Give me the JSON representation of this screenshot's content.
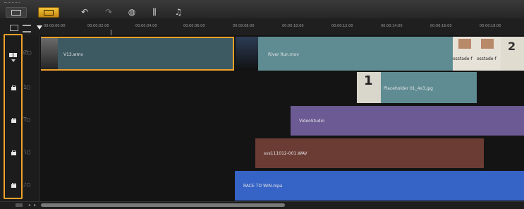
{
  "toolbar": {
    "buttons": [
      {
        "name": "storyboard-view-icon",
        "symbol": ""
      },
      {
        "name": "timeline-view-icon",
        "symbol": ""
      },
      {
        "name": "undo-icon",
        "symbol": "↶"
      },
      {
        "name": "redo-icon",
        "symbol": "↷"
      },
      {
        "name": "record-capture-icon",
        "symbol": "◍"
      },
      {
        "name": "sound-mixer-icon",
        "symbol": "⫼"
      },
      {
        "name": "auto-music-icon",
        "symbol": "♫"
      }
    ]
  },
  "ruler": {
    "times": [
      "00:00:00:00",
      "00:00:02:00",
      "00:00:04:00",
      "00:00:06:00",
      "00:00:08:00",
      "00:00:10:00",
      "00:00:12:00",
      "00:00:14:00",
      "00:00:16:00",
      "00:00:18:00"
    ]
  },
  "tracks": {
    "video": {
      "type_icon": "🎬",
      "clips": [
        {
          "label": "V13.wmv"
        },
        {
          "label": "River Run.mov"
        },
        {
          "label": "osstade-f"
        },
        {
          "label": "osstade-f"
        },
        {
          "label": "2"
        }
      ]
    },
    "overlay": {
      "type_icon": "1▢",
      "clip": {
        "label": "Placeholder 01_4x3.jpg",
        "badge": "1"
      }
    },
    "title": {
      "type_icon": "T▢",
      "clip": {
        "label": "VideoStudio"
      }
    },
    "voice": {
      "type_icon": "∖▢",
      "clip": {
        "label": "svs111012-001.WAV"
      }
    },
    "music": {
      "type_icon": "♪▢",
      "clip": {
        "label": "RACE TO WIN.mpa"
      }
    }
  },
  "colors": {
    "highlight": "#f2a12a",
    "video_clip": "#3d5a63",
    "overlay_clip": "#5f8c93",
    "title_clip": "#6b5a93",
    "voice_clip": "#6b3c34",
    "music_clip": "#3563c6"
  }
}
